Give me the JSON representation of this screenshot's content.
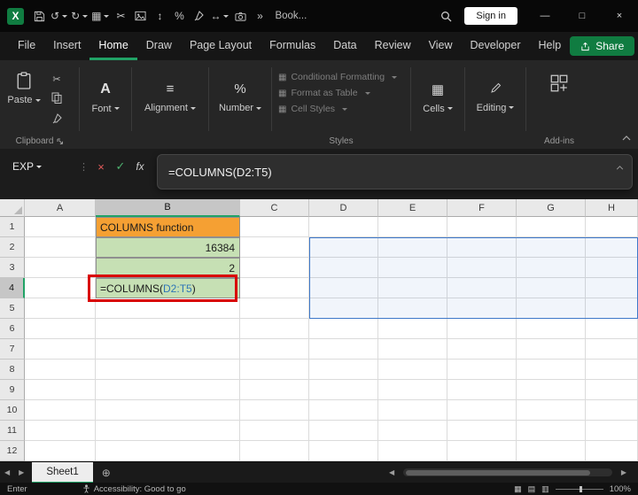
{
  "colors": {
    "excel_green": "#107C41",
    "accent_green": "#21A366",
    "orange_fill": "#F5A033",
    "green_fill": "#C6E0B4",
    "selection_blue": "#3E78C9",
    "highlight_red": "#D90000",
    "range_blue": "#2E75B6"
  },
  "title_bar": {
    "workbook_title": "Book...",
    "sign_in_label": "Sign in"
  },
  "menu": {
    "tabs": [
      "File",
      "Insert",
      "Home",
      "Draw",
      "Page Layout",
      "Formulas",
      "Data",
      "Review",
      "View",
      "Developer",
      "Help"
    ],
    "active_tab": "Home",
    "share_label": "Share"
  },
  "ribbon": {
    "paste_label": "Paste",
    "font_label": "Font",
    "alignment_label": "Alignment",
    "number_label": "Number",
    "styles_items": [
      "Conditional Formatting",
      "Format as Table",
      "Cell Styles"
    ],
    "cells_label": "Cells",
    "editing_label": "Editing",
    "group_labels": {
      "clipboard": "Clipboard",
      "styles": "Styles",
      "addins": "Add-ins"
    }
  },
  "formula_bar": {
    "name_box_value": "EXP",
    "fx_label": "fx",
    "formula_text": "=COLUMNS(D2:T5)"
  },
  "grid": {
    "columns": [
      "A",
      "B",
      "C",
      "D",
      "E",
      "F",
      "G",
      "H"
    ],
    "rows": [
      "1",
      "2",
      "3",
      "4",
      "5",
      "6",
      "7",
      "8",
      "9",
      "10",
      "11",
      "12"
    ],
    "cells": {
      "B1": "COLUMNS function",
      "B2": "16384",
      "B3": "2",
      "B4_prefix": "=COLUMNS(",
      "B4_range": "D2:T5",
      "B4_suffix": ")"
    }
  },
  "sheet_bar": {
    "active_sheet": "Sheet1"
  },
  "status_bar": {
    "mode": "Enter",
    "accessibility": "Accessibility: Good to go",
    "zoom": "100%"
  }
}
